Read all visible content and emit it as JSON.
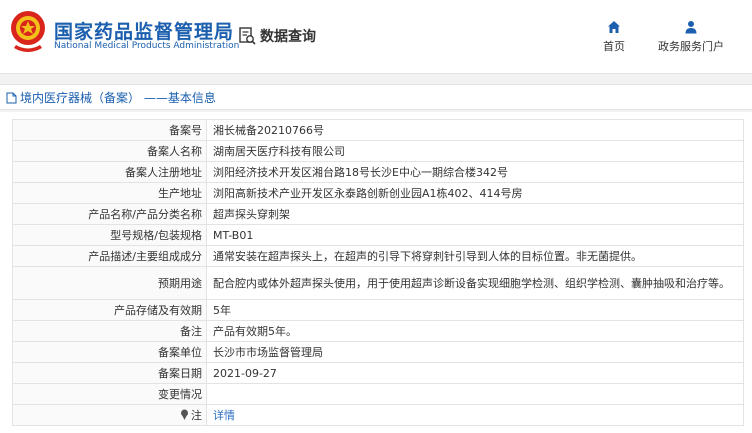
{
  "header": {
    "brand_cn": "国家药品监督管理局",
    "brand_en": "National Medical Products Administration",
    "data_query": "数据查询",
    "nav": [
      {
        "label": "首页",
        "icon": "home-icon"
      },
      {
        "label": "政务服务门户",
        "icon": "user-icon"
      }
    ]
  },
  "breadcrumb": "境内医疗器械（备案） ——基本信息",
  "rows": [
    {
      "k": "备案号",
      "v": "湘长械备20210766号"
    },
    {
      "k": "备案人名称",
      "v": "湖南居天医疗科技有限公司"
    },
    {
      "k": "备案人注册地址",
      "v": "浏阳经济技术开发区湘台路18号长沙E中心一期综合楼342号"
    },
    {
      "k": "生产地址",
      "v": "浏阳高新技术产业开发区永泰路创新创业园A1栋402、414号房"
    },
    {
      "k": "产品名称/产品分类名称",
      "v": "超声探头穿刺架"
    },
    {
      "k": "型号规格/包装规格",
      "v": "MT-B01"
    },
    {
      "k": "产品描述/主要组成成分",
      "v": "通常安装在超声探头上，在超声的引导下将穿刺针引导到人体的目标位置。非无菌提供。"
    },
    {
      "k": "预期用途",
      "v": "配合腔内或体外超声探头使用，用于使用超声诊断设备实现细胞学检测、组织学检测、囊肿抽吸和治疗等。"
    },
    {
      "k": "产品存储及有效期",
      "v": "5年"
    },
    {
      "k": "备注",
      "v": "产品有效期5年。"
    },
    {
      "k": "备案单位",
      "v": "长沙市市场监督管理局"
    },
    {
      "k": "备案日期",
      "v": "2021-09-27"
    },
    {
      "k": "变更情况",
      "v": ""
    },
    {
      "k": "注",
      "v": "详情"
    }
  ],
  "colors": {
    "brand": "#1b5fae",
    "link": "#2b6cc4"
  }
}
